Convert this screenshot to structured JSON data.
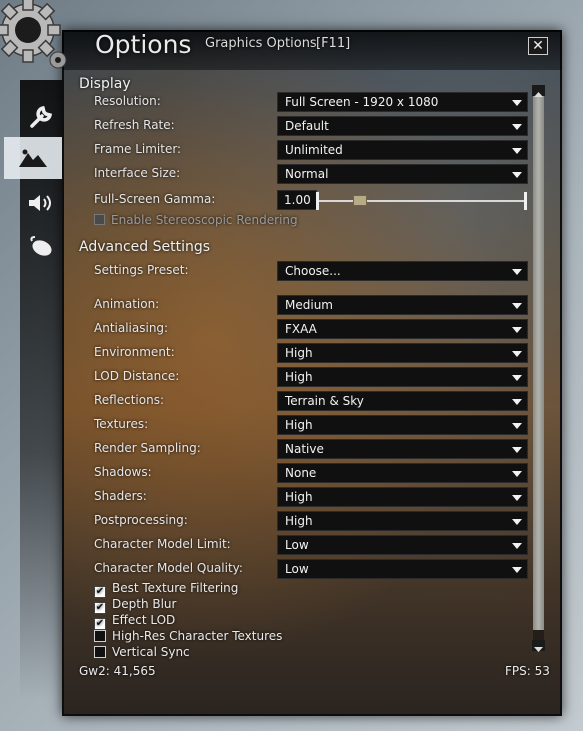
{
  "window": {
    "title": "Options",
    "subtitle": "Graphics Options",
    "shortcut": "[F11]",
    "close_label": "✕"
  },
  "sidebar": {
    "tabs": [
      {
        "icon": "wrench-icon",
        "active": false
      },
      {
        "icon": "mountains-icon",
        "active": true
      },
      {
        "icon": "speaker-icon",
        "active": false
      },
      {
        "icon": "mouse-icon",
        "active": false
      }
    ]
  },
  "display": {
    "header": "Display",
    "resolution": {
      "label": "Resolution:",
      "value": "Full Screen - 1920 x 1080"
    },
    "refresh_rate": {
      "label": "Refresh Rate:",
      "value": "Default"
    },
    "frame_limiter": {
      "label": "Frame Limiter:",
      "value": "Unlimited"
    },
    "interface_size": {
      "label": "Interface Size:",
      "value": "Normal"
    },
    "gamma": {
      "label": "Full-Screen Gamma:",
      "value": "1.00",
      "slider_fraction": 0.2
    },
    "stereo": {
      "label": "Enable Stereoscopic Rendering",
      "checked": false,
      "enabled": false
    }
  },
  "advanced": {
    "header": "Advanced Settings",
    "preset": {
      "label": "Settings Preset:",
      "value": "Choose..."
    },
    "settings": [
      {
        "label": "Animation:",
        "value": "Medium"
      },
      {
        "label": "Antialiasing:",
        "value": "FXAA"
      },
      {
        "label": "Environment:",
        "value": "High"
      },
      {
        "label": "LOD Distance:",
        "value": "High"
      },
      {
        "label": "Reflections:",
        "value": "Terrain & Sky"
      },
      {
        "label": "Textures:",
        "value": "High"
      },
      {
        "label": "Render Sampling:",
        "value": "Native"
      },
      {
        "label": "Shadows:",
        "value": "None"
      },
      {
        "label": "Shaders:",
        "value": "High"
      },
      {
        "label": "Postprocessing:",
        "value": "High"
      },
      {
        "label": "Character Model Limit:",
        "value": "Low"
      },
      {
        "label": "Character Model Quality:",
        "value": "Low"
      }
    ],
    "checkboxes": [
      {
        "label": "Best Texture Filtering",
        "checked": true
      },
      {
        "label": "Depth Blur",
        "checked": true
      },
      {
        "label": "Effect LOD",
        "checked": true
      },
      {
        "label": "High-Res Character Textures",
        "checked": false
      },
      {
        "label": "Vertical Sync",
        "checked": false
      }
    ]
  },
  "footer": {
    "build": "Gw2: 41,565",
    "fps": "FPS: 53"
  },
  "colors": {
    "accent": "#f2f2f2",
    "dropdown_bg": "#101010",
    "slider_thumb": "#b7aa86"
  }
}
